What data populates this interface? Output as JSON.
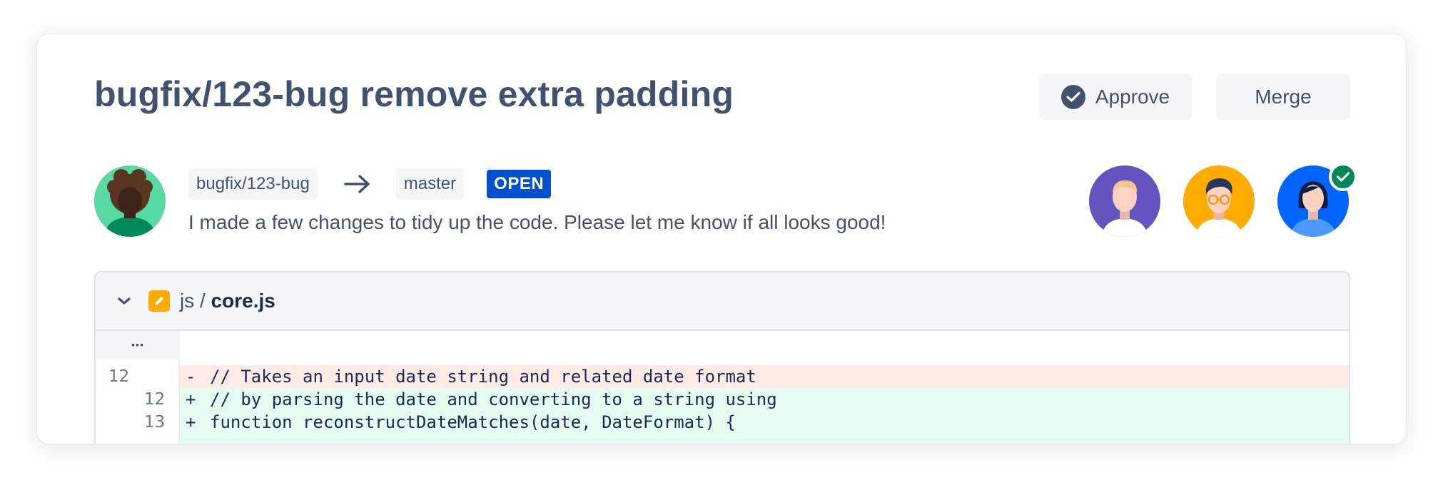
{
  "pull_request": {
    "title": "bugfix/123-bug remove extra padding",
    "source_branch": "bugfix/123-bug",
    "target_branch": "master",
    "status": "OPEN",
    "description": "I made a few changes to tidy up the code. Please let me know if all looks good!"
  },
  "actions": {
    "approve_label": "Approve",
    "merge_label": "Merge"
  },
  "file": {
    "folder": "js /",
    "name": "core.js"
  },
  "diff": {
    "ellipsis": "⋯",
    "lines": [
      {
        "type": "del",
        "old": "12",
        "new": "",
        "sign": "-",
        "code": "// Takes an input date string and related date format"
      },
      {
        "type": "add",
        "old": "",
        "new": "12",
        "sign": "+",
        "code": "// by parsing the date and converting to a string using"
      },
      {
        "type": "add",
        "old": "",
        "new": "13",
        "sign": "+",
        "code": "function reconstructDateMatches(date, DateFormat) {"
      }
    ]
  },
  "colors": {
    "status_bg": "#0052cc",
    "approved_badge": "#00875a",
    "deleted_line_bg": "#ffebe6",
    "added_line_bg": "#e3fcef",
    "text": "#42526e"
  }
}
